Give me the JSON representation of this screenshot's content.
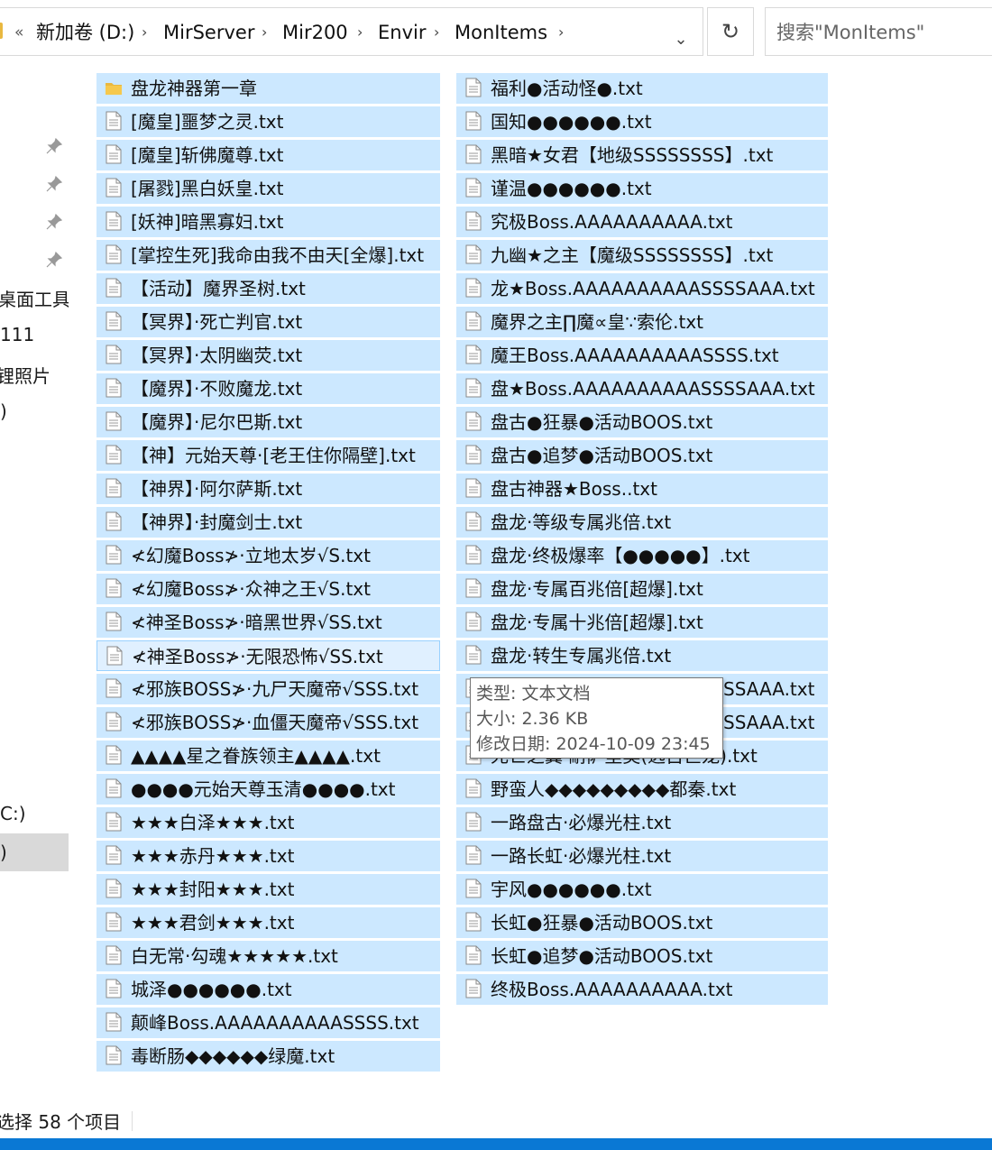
{
  "breadcrumb": {
    "overflow": "«",
    "items": [
      "新加卷 (D:)",
      "MirServer",
      "Mir200",
      "Envir",
      "MonItems"
    ]
  },
  "search": {
    "placeholder": "搜索\"MonItems\""
  },
  "nav": {
    "items": [
      "桌面工具",
      "111",
      "锂照片",
      ")",
      "C:)",
      ")"
    ]
  },
  "files": {
    "column1": [
      {
        "name": "盘龙神器第一章",
        "type": "folder"
      },
      {
        "name": "[魔皇]噩梦之灵.txt",
        "type": "text"
      },
      {
        "name": "[魔皇]斩佛魔尊.txt",
        "type": "text"
      },
      {
        "name": "[屠戮]黑白妖皇.txt",
        "type": "text"
      },
      {
        "name": "[妖神]暗黑寡妇.txt",
        "type": "text"
      },
      {
        "name": "[掌控生死]我命由我不由天[全爆].txt",
        "type": "text"
      },
      {
        "name": "【活动】魔界圣树.txt",
        "type": "text"
      },
      {
        "name": "【冥界】·死亡判官.txt",
        "type": "text"
      },
      {
        "name": "【冥界】·太阴幽荧.txt",
        "type": "text"
      },
      {
        "name": "【魔界】·不败魔龙.txt",
        "type": "text"
      },
      {
        "name": "【魔界】·尼尔巴斯.txt",
        "type": "text"
      },
      {
        "name": "【神】元始天尊·[老王住你隔壁].txt",
        "type": "text"
      },
      {
        "name": "【神界】·阿尔萨斯.txt",
        "type": "text"
      },
      {
        "name": "【神界】·封魔剑士.txt",
        "type": "text"
      },
      {
        "name": "≮幻魔Boss≯·立地太岁√S.txt",
        "type": "text"
      },
      {
        "name": "≮幻魔Boss≯·众神之王√S.txt",
        "type": "text"
      },
      {
        "name": "≮神圣Boss≯·暗黑世界√SS.txt",
        "type": "text"
      },
      {
        "name": "≮神圣Boss≯·无限恐怖√SS.txt",
        "type": "text",
        "state": "hover"
      },
      {
        "name": "≮邪族BOSS≯·九尸天魔帝√SSS.txt",
        "type": "text"
      },
      {
        "name": "≮邪族BOSS≯·血僵天魔帝√SSS.txt",
        "type": "text"
      },
      {
        "name": "▲▲▲▲星之眷族领主▲▲▲▲.txt",
        "type": "text"
      },
      {
        "name": "●●●●元始天尊玉清●●●●.txt",
        "type": "text"
      },
      {
        "name": "★★★白泽★★★.txt",
        "type": "text"
      },
      {
        "name": "★★★赤丹★★★.txt",
        "type": "text"
      },
      {
        "name": "★★★封阳★★★.txt",
        "type": "text"
      },
      {
        "name": "★★★君剑★★★.txt",
        "type": "text"
      },
      {
        "name": "白无常·勾魂★★★★★.txt",
        "type": "text"
      },
      {
        "name": "城泽●●●●●●.txt",
        "type": "text"
      },
      {
        "name": "颠峰Boss.AAAAAAAAAASSSS.txt",
        "type": "text"
      },
      {
        "name": "毒断肠◆◆◆◆◆◆绿魔.txt",
        "type": "text"
      }
    ],
    "column2": [
      {
        "name": "福利●活动怪●.txt",
        "type": "text"
      },
      {
        "name": "国知●●●●●●.txt",
        "type": "text"
      },
      {
        "name": "黑暗★女君【地级SSSSSSSS】.txt",
        "type": "text"
      },
      {
        "name": "谨温●●●●●●.txt",
        "type": "text"
      },
      {
        "name": "究极Boss.AAAAAAAAAA.txt",
        "type": "text"
      },
      {
        "name": "九幽★之主【魔级SSSSSSSS】.txt",
        "type": "text"
      },
      {
        "name": "龙★Boss.AAAAAAAAAASSSSAAA.txt",
        "type": "text"
      },
      {
        "name": "魔界之主∏魔∝皇∵索伦.txt",
        "type": "text"
      },
      {
        "name": "魔王Boss.AAAAAAAAAASSSS.txt",
        "type": "text"
      },
      {
        "name": "盘★Boss.AAAAAAAAAASSSSAAA.txt",
        "type": "text"
      },
      {
        "name": "盘古●狂暴●活动BOOS.txt",
        "type": "text"
      },
      {
        "name": "盘古●追梦●活动BOOS.txt",
        "type": "text"
      },
      {
        "name": "盘古神器★Boss..txt",
        "type": "text"
      },
      {
        "name": "盘龙·等级专属兆倍.txt",
        "type": "text"
      },
      {
        "name": "盘龙·终极爆率【●●●●●】.txt",
        "type": "text"
      },
      {
        "name": "盘龙·专属百兆倍[超爆].txt",
        "type": "text"
      },
      {
        "name": "盘龙·专属十兆倍[超爆].txt",
        "type": "text"
      },
      {
        "name": "盘龙·转生专属兆倍.txt",
        "type": "text"
      },
      {
        "name": "SSAAA.txt",
        "type": "text",
        "partial": true
      },
      {
        "name": "SSAAA.txt",
        "type": "text",
        "partial": true
      },
      {
        "name": "死亡之翼·耐萨里奥(远古巨龙).txt",
        "type": "text"
      },
      {
        "name": "野蛮人◆◆◆◆◆◆◆◆◆都秦.txt",
        "type": "text"
      },
      {
        "name": "一路盘古·必爆光柱.txt",
        "type": "text"
      },
      {
        "name": "一路长虹·必爆光柱.txt",
        "type": "text"
      },
      {
        "name": "宇风●●●●●●.txt",
        "type": "text"
      },
      {
        "name": "长虹●狂暴●活动BOOS.txt",
        "type": "text"
      },
      {
        "name": "长虹●追梦●活动BOOS.txt",
        "type": "text"
      },
      {
        "name": "终极Boss.AAAAAAAAAA.txt",
        "type": "text"
      }
    ]
  },
  "tooltip": {
    "type": "类型: 文本文档",
    "size": "大小: 2.36 KB",
    "modified": "修改日期: 2024-10-09 23:45"
  },
  "status": {
    "text": "选择 58 个项目"
  },
  "colors": {
    "selection": "#cce8ff",
    "hover": "#e0f0ff",
    "hover_border": "#99d1ff",
    "folder": "#e9b840",
    "accent": "#0a78d4"
  },
  "icons": {
    "folder": "folder-icon",
    "text": "text-file-icon",
    "pin": "pin-icon",
    "refresh": "refresh-icon",
    "chevron": "chevron-right-icon",
    "dropdown": "chevron-down-icon"
  }
}
